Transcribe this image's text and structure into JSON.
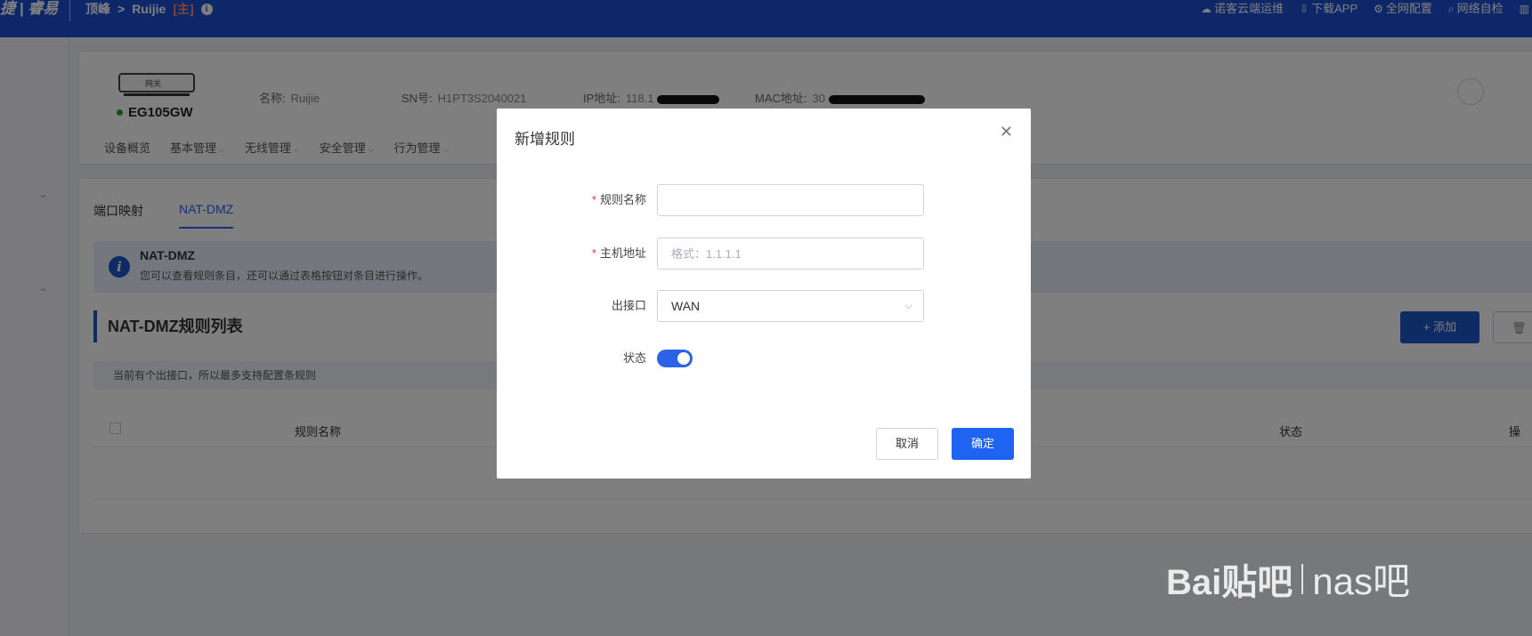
{
  "topbar": {
    "brand": "捷 | 睿易",
    "crumb_root": "顶峰",
    "crumb_sep": ">",
    "crumb_device": "Ruijie",
    "crumb_role": "[主]",
    "links": [
      {
        "icon": "cloud-icon",
        "label": "诺客云端运维"
      },
      {
        "icon": "download-icon",
        "label": "下载APP"
      },
      {
        "icon": "network-config-icon",
        "label": "全网配置"
      },
      {
        "icon": "search-icon",
        "label": "网络自检"
      }
    ]
  },
  "device": {
    "image_label": "网关",
    "model": "EG105GW",
    "name_label": "名称:",
    "name_value": "Ruijie",
    "sn_label": "SN号:",
    "sn_value": "H1PT3S2040021",
    "ip_label": "IP地址:",
    "ip_value": "118.1",
    "mac_label": "MAC地址:",
    "mac_value": "30",
    "tabs": [
      {
        "label": "设备概览",
        "has_caret": false
      },
      {
        "label": "基本管理",
        "has_caret": true
      },
      {
        "label": "无线管理",
        "has_caret": true
      },
      {
        "label": "安全管理",
        "has_caret": true
      },
      {
        "label": "行为管理",
        "has_caret": true
      }
    ]
  },
  "main": {
    "tabs": [
      {
        "label": "端口映射",
        "active": false
      },
      {
        "label": "NAT-DMZ",
        "active": true
      }
    ],
    "notice_title": "NAT-DMZ",
    "notice_desc": "您可以查看规则条目，还可以通过表格按钮对条目进行操作。",
    "section_title": "NAT-DMZ规则列表",
    "add_button": "+ 添加",
    "hint": "当前有个出接口，所以最多支持配置条规则",
    "columns": [
      "规则名称",
      "状态",
      "操"
    ]
  },
  "dialog": {
    "title": "新增规则",
    "fields": {
      "rule_name_label": "规则名称",
      "rule_name_value": "",
      "host_label": "主机地址",
      "host_placeholder": "格式：1.1.1.1",
      "iface_label": "出接口",
      "iface_value": "WAN",
      "status_label": "状态",
      "status_on": true
    },
    "cancel_button": "取消",
    "ok_button": "确定"
  },
  "watermark": {
    "text": "Bai贴吧",
    "site": "nas吧"
  },
  "colors": {
    "topbar": "#1d4fd1",
    "primary": "#2b63e6",
    "required": "#e34"
  }
}
